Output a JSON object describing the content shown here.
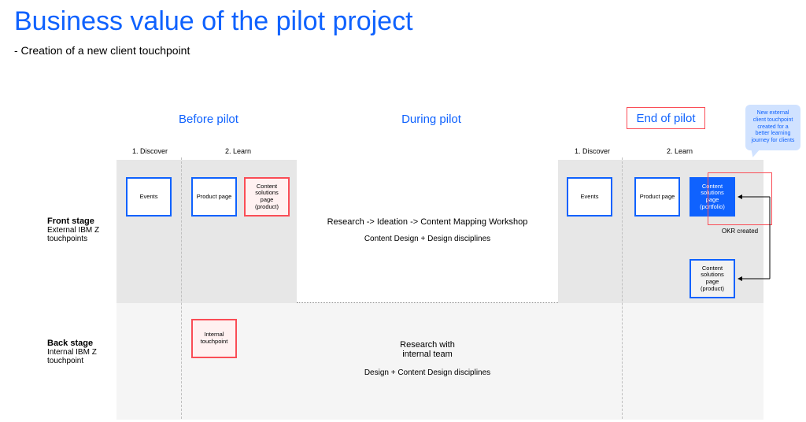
{
  "header": {
    "title": "Business value of the pilot project",
    "subtitle": "- Creation of a new client touchpoint"
  },
  "columns": {
    "before": "Before pilot",
    "during": "During pilot",
    "end": "End of pilot"
  },
  "subcols": {
    "discover": "1. Discover",
    "learn": "2. Learn"
  },
  "rows": {
    "front_title": "Front stage",
    "front_desc": "External IBM Z touchpoints",
    "back_title": "Back stage",
    "back_desc": "Internal IBM Z touchpoint"
  },
  "cards": {
    "events": "Events",
    "product_page": "Product page",
    "content_product": "Content solutions page (product)",
    "content_portfolio": "Content solutions page (portfolio)",
    "internal_touchpoint": "Internal touchpoint"
  },
  "mid": {
    "front_line1": "Research -> Ideation -> Content Mapping Workshop",
    "front_line2": "Content Design + Design disciplines",
    "back_line1": "Research with internal team",
    "back_line2": "Design + Content Design disciplines"
  },
  "okr_label": "OKR created",
  "bubble": "New external client touchpoint created for a better learning journey for clients"
}
